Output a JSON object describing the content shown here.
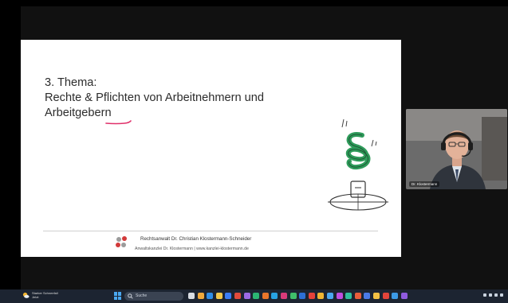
{
  "slide": {
    "title_line1": "3. Thema:",
    "title_line2": "Rechte & Pflichten von Arbeitnehmern und",
    "title_line3": "Arbeitgebern",
    "footer_name": "Rechtsanwalt Dr. Christian Klostermann-Schneider",
    "footer_sub": "Anwaltskanzlei Dr. Klostermann  |  www.kanzlei-klostermann.de"
  },
  "video": {
    "participant_label": "Dr. Klostermann"
  },
  "taskbar": {
    "weather_line1": "Starker Schneefall",
    "weather_line2": "Jetzt",
    "search_placeholder": "Suche",
    "colors": {
      "background": "#1c2431",
      "accent": "#4aa7f0"
    },
    "app_icons": [
      {
        "name": "task-view-icon",
        "color": "#d9dde3"
      },
      {
        "name": "pen-icon",
        "color": "#f1a93b"
      },
      {
        "name": "edge-icon",
        "color": "#2f8ee8"
      },
      {
        "name": "explorer-icon",
        "color": "#f3c84b"
      },
      {
        "name": "zoom-icon",
        "color": "#3b7df5"
      },
      {
        "name": "app-icon-6",
        "color": "#e24a3b"
      },
      {
        "name": "app-icon-7",
        "color": "#9b6ae6"
      },
      {
        "name": "app-icon-8",
        "color": "#2bb673"
      },
      {
        "name": "app-icon-9",
        "color": "#e9762b"
      },
      {
        "name": "app-icon-10",
        "color": "#27a3e4"
      },
      {
        "name": "app-icon-11",
        "color": "#d93b7b"
      },
      {
        "name": "app-icon-12",
        "color": "#3fbf6a"
      },
      {
        "name": "app-icon-13",
        "color": "#2d6fd6"
      },
      {
        "name": "app-icon-14",
        "color": "#e6423a"
      },
      {
        "name": "app-icon-15",
        "color": "#f0b532"
      },
      {
        "name": "app-icon-16",
        "color": "#4aa7f0"
      },
      {
        "name": "app-icon-17",
        "color": "#c04de0"
      },
      {
        "name": "app-icon-18",
        "color": "#2fbf9b"
      },
      {
        "name": "app-icon-19",
        "color": "#e85d3b"
      },
      {
        "name": "app-icon-20",
        "color": "#4b7be8"
      },
      {
        "name": "app-icon-21",
        "color": "#f2c144"
      },
      {
        "name": "app-icon-22",
        "color": "#e2443b"
      },
      {
        "name": "app-icon-23",
        "color": "#3c9be8"
      },
      {
        "name": "app-icon-24",
        "color": "#8f5be0"
      }
    ]
  }
}
